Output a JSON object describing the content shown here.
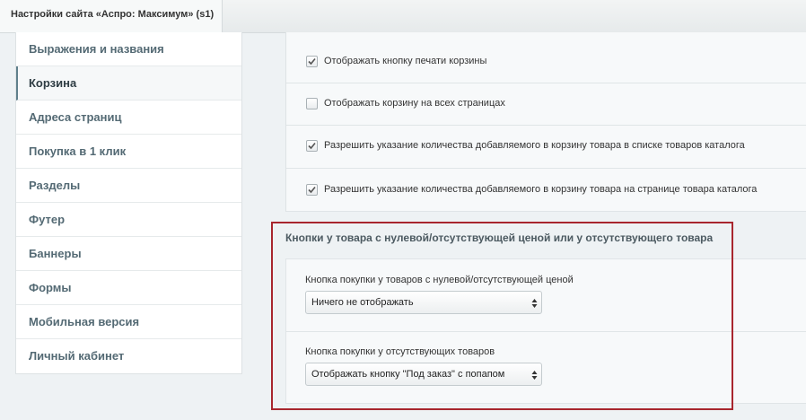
{
  "window": {
    "tab_title": "Настройки сайта «Аспро: Максимум» (s1)"
  },
  "sidebar": {
    "items": [
      {
        "label": "Выражения и названия",
        "active": false
      },
      {
        "label": "Корзина",
        "active": true
      },
      {
        "label": "Адреса страниц",
        "active": false
      },
      {
        "label": "Покупка в 1 клик",
        "active": false
      },
      {
        "label": "Разделы",
        "active": false
      },
      {
        "label": "Футер",
        "active": false
      },
      {
        "label": "Баннеры",
        "active": false
      },
      {
        "label": "Формы",
        "active": false
      },
      {
        "label": "Мобильная версия",
        "active": false
      },
      {
        "label": "Личный кабинет",
        "active": false
      }
    ]
  },
  "checkboxes": [
    {
      "label": "Отображать кнопку печати корзины",
      "checked": true
    },
    {
      "label": "Отображать корзину на всех страницах",
      "checked": false
    },
    {
      "label": "Разрешить указание количества добавляемого в корзину товара в списке товаров каталога",
      "checked": true
    },
    {
      "label": "Разрешить указание количества добавляемого в корзину товара на странице товара каталога",
      "checked": true
    }
  ],
  "group": {
    "title": "Кнопки у товара с нулевой/отсутствующей ценой или у отсутствующего товара",
    "fields": [
      {
        "label": "Кнопка покупки у товаров с нулевой/отсутствующей ценой",
        "value": "Ничего не отображать"
      },
      {
        "label": "Кнопка покупки у отсутствующих товаров",
        "value": "Отображать кнопку \"Под заказ\" с попапом"
      }
    ]
  },
  "colors": {
    "highlight_border": "#a8262e",
    "sidebar_text": "#546a74"
  }
}
